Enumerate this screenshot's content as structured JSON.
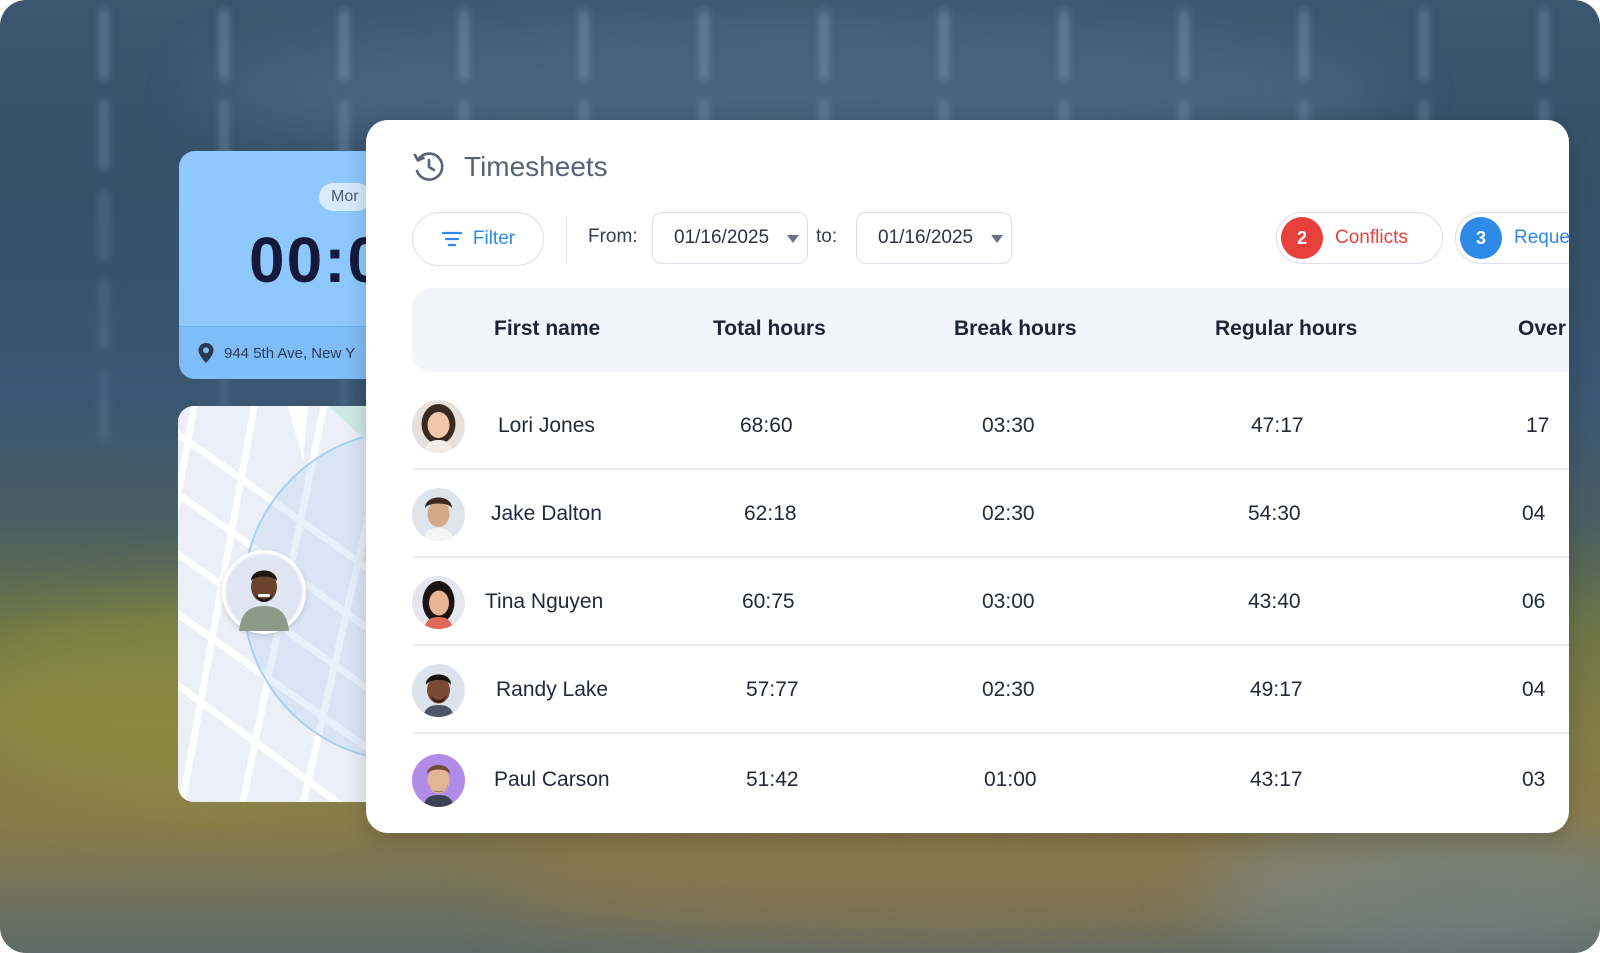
{
  "clock": {
    "pill_label": "Mor",
    "time": "00:0",
    "address": "944 5th Ave, New Y"
  },
  "timesheets": {
    "title": "Timesheets",
    "filter_label": "Filter",
    "from_label": "From:",
    "from_date": "01/16/2025",
    "to_label": "to:",
    "to_date": "01/16/2025",
    "conflicts_count": "2",
    "conflicts_label": "Conflicts",
    "requests_count": "3",
    "requests_label": "Reques"
  },
  "table": {
    "headers": [
      "First name",
      "Total hours",
      "Break hours",
      "Regular hours",
      "Over"
    ],
    "rows": [
      {
        "name": "Lori Jones",
        "total": "68:60",
        "break": "03:30",
        "regular": "47:17",
        "over": "17"
      },
      {
        "name": "Jake Dalton",
        "total": "62:18",
        "break": "02:30",
        "regular": "54:30",
        "over": "04"
      },
      {
        "name": "Tina Nguyen",
        "total": "60:75",
        "break": "03:00",
        "regular": "43:40",
        "over": "06"
      },
      {
        "name": "Randy Lake",
        "total": "57:77",
        "break": "02:30",
        "regular": "49:17",
        "over": "04"
      },
      {
        "name": "Paul Carson",
        "total": "51:42",
        "break": "01:00",
        "regular": "43:17",
        "over": "03"
      }
    ]
  },
  "colors": {
    "accent": "#2e8ae6",
    "conflict": "#e8413c",
    "request": "#2e8ae6",
    "clock_card": "#8ec8ff"
  },
  "icons": {
    "title_icon": "history-clock-icon",
    "filter_icon": "filter-lines-icon",
    "location_icon": "map-pin-icon"
  }
}
